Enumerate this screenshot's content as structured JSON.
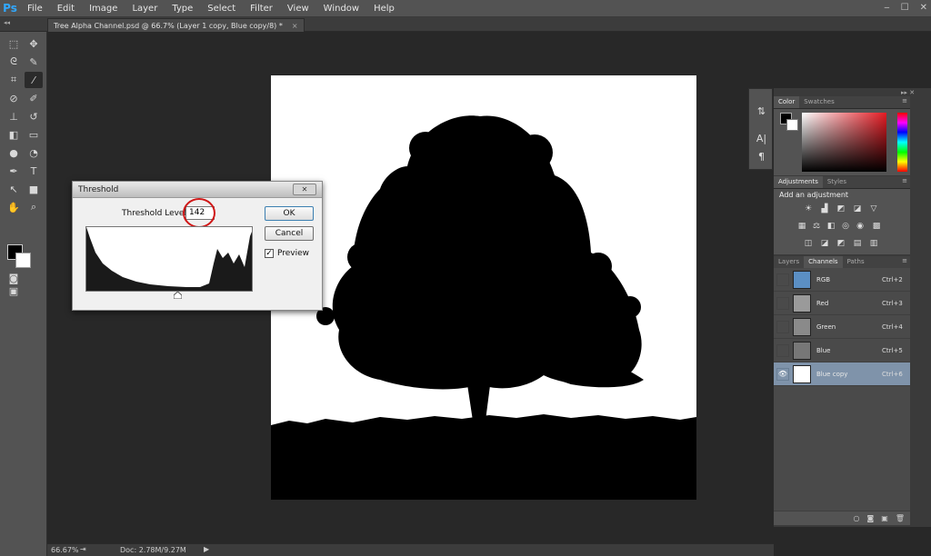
{
  "app": {
    "logo": "Ps",
    "menu": [
      "File",
      "Edit",
      "Image",
      "Layer",
      "Type",
      "Select",
      "Filter",
      "View",
      "Window",
      "Help"
    ],
    "window_controls": [
      "‒",
      "☐",
      "✕"
    ]
  },
  "document": {
    "tab_title": "Tree Alpha Channel.psd @ 66.7% (Layer 1 copy, Blue copy/8) *",
    "tab_close": "×",
    "collapse": "◂◂"
  },
  "status": {
    "zoom": "66.67%",
    "doc_info": "Doc: 2.78M/9.27M",
    "arrow": "▶",
    "export": "⇥"
  },
  "threshold_dialog": {
    "title": "Threshold",
    "close": "✕",
    "level_label": "Threshold Level:",
    "level_value": "142",
    "ok": "OK",
    "cancel": "Cancel",
    "preview_label": "Preview",
    "preview_checked": "✓"
  },
  "panels": {
    "color": {
      "tabs": [
        "Color",
        "Swatches"
      ],
      "menu": "≡"
    },
    "adjustments": {
      "tabs": [
        "Adjustments",
        "Styles"
      ],
      "title": "Add an adjustment",
      "menu": "≡"
    },
    "layers": {
      "tabs": [
        "Layers",
        "Channels",
        "Paths"
      ],
      "active": "Channels",
      "menu": "≡"
    },
    "dock_arrows": "▸▸ ✕",
    "mini_strip": [
      "⇅",
      "A|",
      "¶"
    ],
    "channels": [
      {
        "name": "RGB",
        "shortcut": "Ctrl+2",
        "visible": "",
        "thumb": "#5b8fc4"
      },
      {
        "name": "Red",
        "shortcut": "Ctrl+3",
        "visible": "",
        "thumb": "#9a9a9a"
      },
      {
        "name": "Green",
        "shortcut": "Ctrl+4",
        "visible": "",
        "thumb": "#8a8a8a"
      },
      {
        "name": "Blue",
        "shortcut": "Ctrl+5",
        "visible": "",
        "thumb": "#777777"
      },
      {
        "name": "Blue copy",
        "shortcut": "Ctrl+6",
        "visible": "👁",
        "thumb": "#ffffff"
      }
    ],
    "footer_icons": [
      "○",
      "◙",
      "▣",
      "🗑"
    ]
  },
  "colors": {
    "accent": "#31a8ff",
    "selection": "#7f93aa",
    "red_circle": "#d01818"
  }
}
